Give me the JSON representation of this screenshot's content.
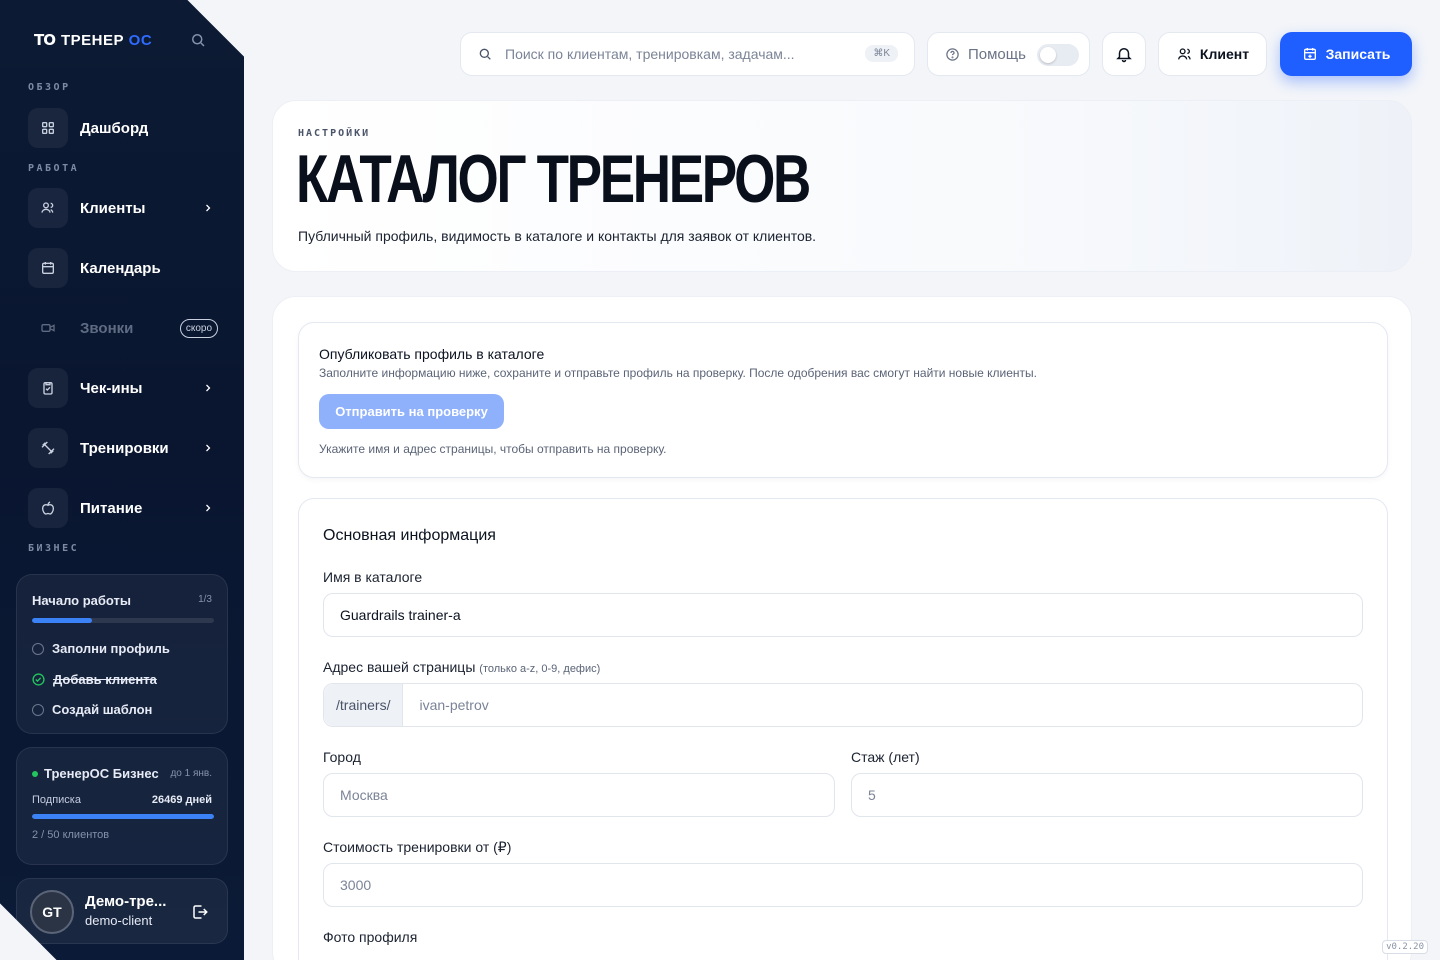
{
  "brand": {
    "logo": "TO",
    "name_main": "ТРЕНЕР",
    "name_accent": "ОС"
  },
  "sidebar": {
    "sections": {
      "overview": "ОБЗОР",
      "work": "РАБОТА",
      "business": "БИЗНЕС"
    },
    "items": [
      {
        "label": "Дашборд",
        "icon": "grid-icon"
      },
      {
        "label": "Клиенты",
        "icon": "users-icon"
      },
      {
        "label": "Календарь",
        "icon": "calendar-icon"
      },
      {
        "label": "Звонки",
        "icon": "video-icon",
        "badge": "скоро"
      },
      {
        "label": "Чек-ины",
        "icon": "clipboard-check-icon"
      },
      {
        "label": "Тренировки",
        "icon": "dumbbell-icon"
      },
      {
        "label": "Питание",
        "icon": "apple-icon"
      }
    ],
    "onboarding": {
      "title": "Начало работы",
      "count": "1/3",
      "progress": 0.33,
      "tasks": [
        {
          "label": "Заполни профиль",
          "done": false
        },
        {
          "label": "Добавь клиента",
          "done": true
        },
        {
          "label": "Создай шаблон",
          "done": false
        }
      ]
    },
    "business": {
      "title": "ТренерОС Бизнес",
      "until": "до 1 янв.",
      "sub_label": "Подписка",
      "sub_days": "26469 дней",
      "progress": 1.0,
      "clients": "2 / 50 клиентов"
    },
    "user": {
      "initials": "GT",
      "name": "Демо-тре...",
      "login": "demo-client"
    }
  },
  "topbar": {
    "search_placeholder": "Поиск по клиентам, тренировкам, задачам...",
    "search_kbd": "⌘K",
    "help_label": "Помощь",
    "client_label": "Клиент",
    "book_label": "Записать"
  },
  "header": {
    "eyebrow": "НАСТРОЙКИ",
    "title": "КАТАЛОГ ТРЕНЕРОВ",
    "subtitle": "Публичный профиль, видимость в каталоге и контакты для заявок от клиентов."
  },
  "publish": {
    "title": "Опубликовать профиль в каталоге",
    "description": "Заполните информацию ниже, сохраните и отправьте профиль на проверку. После одобрения вас смогут найти новые клиенты.",
    "button": "Отправить на проверку",
    "hint": "Укажите имя и адрес страницы, чтобы отправить на проверку."
  },
  "info": {
    "title": "Основная информация",
    "name_label": "Имя в каталоге",
    "name_value": "Guardrails trainer-a",
    "slug_label": "Адрес вашей страницы",
    "slug_hint": "(только a-z, 0-9, дефис)",
    "slug_prefix": "/trainers/",
    "slug_placeholder": "ivan-petrov",
    "city_label": "Город",
    "city_placeholder": "Москва",
    "exp_label": "Стаж (лет)",
    "exp_placeholder": "5",
    "price_label": "Стоимость тренировки от (₽)",
    "price_placeholder": "3000",
    "photo_label": "Фото профиля"
  },
  "version": "v0.2.20"
}
